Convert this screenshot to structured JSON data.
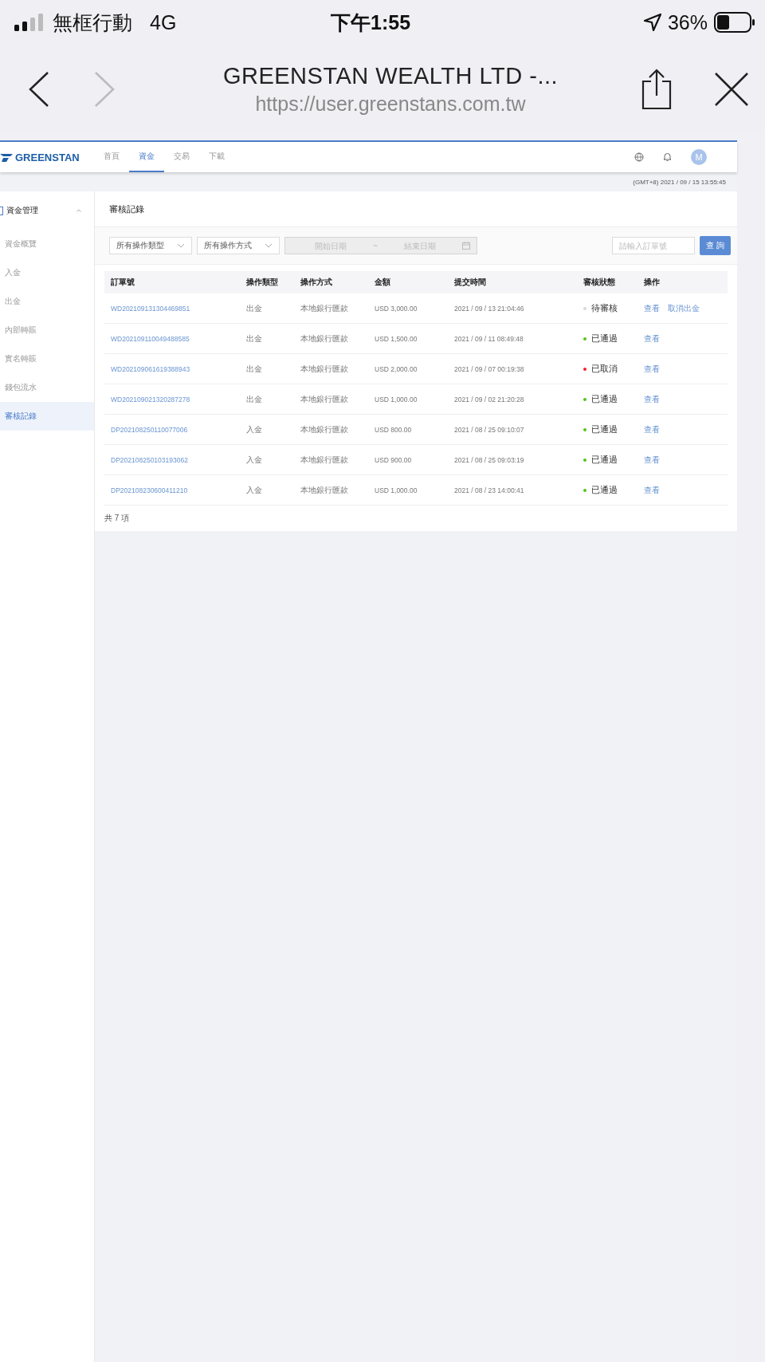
{
  "status_bar": {
    "carrier": "無框行動",
    "network": "4G",
    "time": "下午1:55",
    "battery": "36%"
  },
  "browser": {
    "title": "GREENSTAN WEALTH LTD -...",
    "url": "https://user.greenstans.com.tw",
    "forward_disabled": true
  },
  "nav": {
    "logo": "GREENSTAN",
    "tabs": [
      {
        "label": "首頁",
        "selected": false
      },
      {
        "label": "資金",
        "selected": true
      },
      {
        "label": "交易",
        "selected": false
      },
      {
        "label": "下載",
        "selected": false
      }
    ],
    "avatar": "M"
  },
  "timestamp": "(GMT+8) 2021 / 09 / 15 13:55:45",
  "sidebar": {
    "group": {
      "label": "資金管理",
      "expanded": true
    },
    "items": [
      {
        "label": "資金概覽",
        "selected": false
      },
      {
        "label": "入金",
        "selected": false
      },
      {
        "label": "出金",
        "selected": false
      },
      {
        "label": "內部轉賬",
        "selected": false
      },
      {
        "label": "實名轉賬",
        "selected": false
      },
      {
        "label": "錢包流水",
        "selected": false
      },
      {
        "label": "審核記錄",
        "selected": true
      }
    ]
  },
  "page_title": "審核記錄",
  "filters": {
    "type_select": "所有操作類型",
    "method_select": "所有操作方式",
    "start_date": {
      "placeholder": "開始日期"
    },
    "separator": "~",
    "end_date": {
      "placeholder": "結束日期"
    },
    "date_disabled": true,
    "order_search": {
      "placeholder": "請輸入訂單號"
    },
    "query_button": "查 詢"
  },
  "table": {
    "columns": [
      "訂單號",
      "操作類型",
      "操作方式",
      "金額",
      "提交時間",
      "審核狀態",
      "操作"
    ],
    "rows": [
      {
        "order": "WD202109131304469851",
        "type": "出金",
        "method": "本地銀行匯款",
        "amount": "USD 3,000.00",
        "time": "2021 / 09 / 13 21:04:46",
        "status": "待審核",
        "color": "#d9d9d9",
        "actions": [
          "查看",
          "取消出金"
        ]
      },
      {
        "order": "WD202109110049488585",
        "type": "出金",
        "method": "本地銀行匯款",
        "amount": "USD 1,500.00",
        "time": "2021 / 09 / 11 08:49:48",
        "status": "已通過",
        "color": "#52c41a",
        "actions": [
          "查看"
        ]
      },
      {
        "order": "WD202109061619388943",
        "type": "出金",
        "method": "本地銀行匯款",
        "amount": "USD 2,000.00",
        "time": "2021 / 09 / 07 00:19:38",
        "status": "已取消",
        "color": "#f5222d",
        "actions": [
          "查看"
        ]
      },
      {
        "order": "WD202109021320287278",
        "type": "出金",
        "method": "本地銀行匯款",
        "amount": "USD 1,000.00",
        "time": "2021 / 09 / 02 21:20:28",
        "status": "已通過",
        "color": "#52c41a",
        "actions": [
          "查看"
        ]
      },
      {
        "order": "DP202108250110077006",
        "type": "入金",
        "method": "本地銀行匯款",
        "amount": "USD 800.00",
        "time": "2021 / 08 / 25 09:10:07",
        "status": "已通過",
        "color": "#52c41a",
        "actions": [
          "查看"
        ]
      },
      {
        "order": "DP202108250103193062",
        "type": "入金",
        "method": "本地銀行匯款",
        "amount": "USD 900.00",
        "time": "2021 / 08 / 25 09:03:19",
        "status": "已通過",
        "color": "#52c41a",
        "actions": [
          "查看"
        ]
      },
      {
        "order": "DP202108230600411210",
        "type": "入金",
        "method": "本地銀行匯款",
        "amount": "USD 1,000.00",
        "time": "2021 / 08 / 23 14:00:41",
        "status": "已通過",
        "color": "#52c41a",
        "actions": [
          "查看"
        ]
      }
    ]
  },
  "total": "共 7 項"
}
